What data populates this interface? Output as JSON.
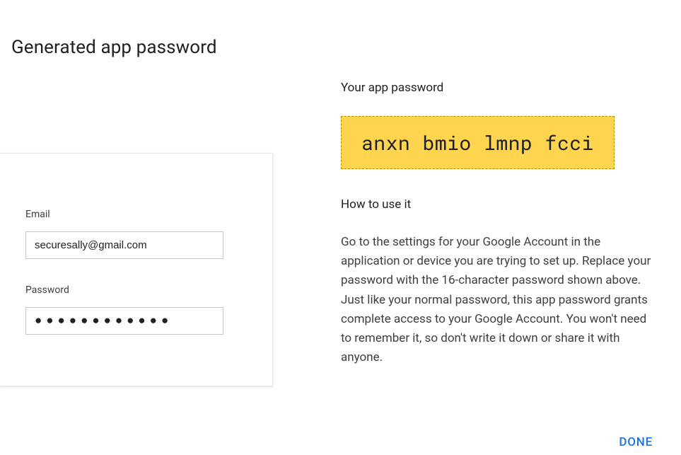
{
  "title": "Generated app password",
  "left": {
    "emailLabel": "Email",
    "emailValue": "securesally@gmail.com",
    "passwordLabel": "Password",
    "passwordMasked": "●●●●●●●●●●●●"
  },
  "right": {
    "heading1": "Your app password",
    "generatedPassword": "anxn bmio lmnp fcci",
    "heading2": "How to use it",
    "instructionsPara1": "Go to the settings for your Google Account in the application or device you are trying to set up. Replace your password with the 16-character password shown above.",
    "instructionsPara2": "Just like your normal password, this app password grants complete access to your Google Account. You won't need to remember it, so don't write it down or share it with anyone."
  },
  "actions": {
    "doneLabel": "DONE"
  }
}
